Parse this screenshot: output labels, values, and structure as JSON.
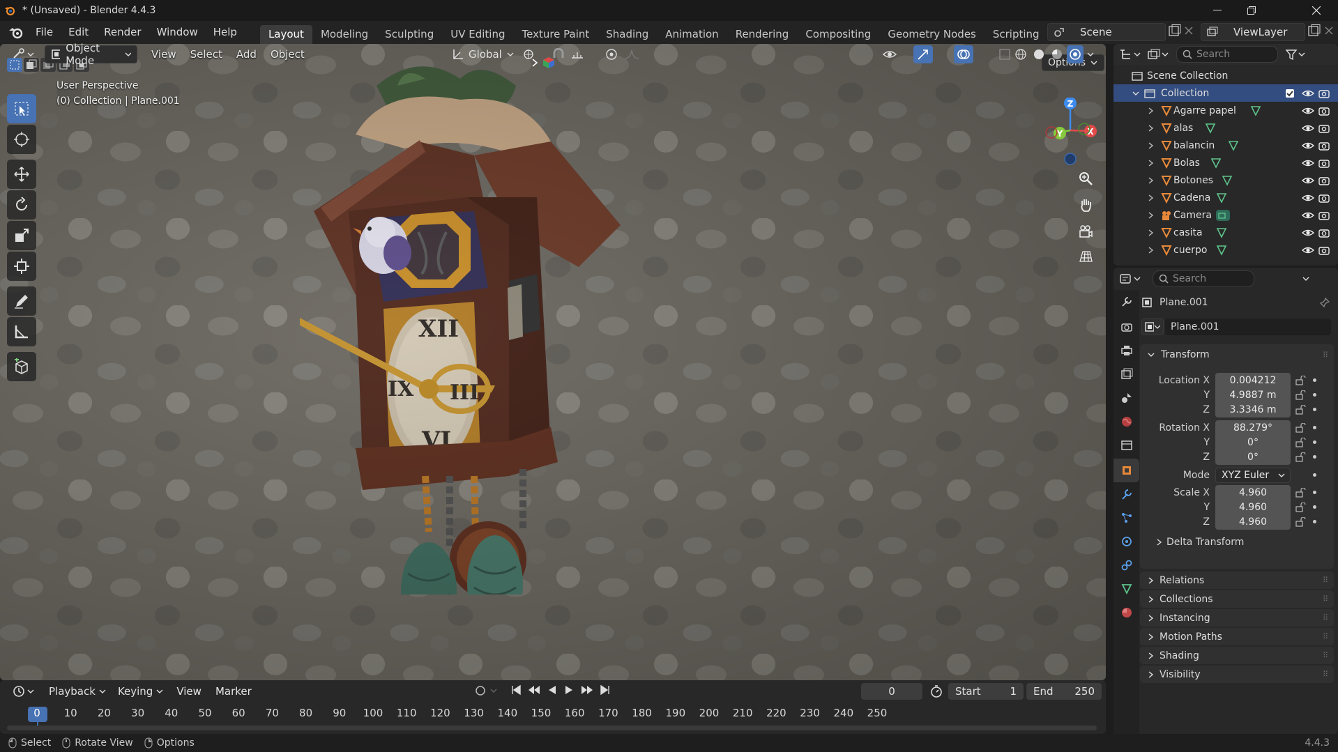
{
  "window": {
    "title": "* (Unsaved) - Blender 4.4.3"
  },
  "menu": [
    "File",
    "Edit",
    "Render",
    "Window",
    "Help"
  ],
  "workspaces": [
    {
      "label": "Layout",
      "active": true
    },
    {
      "label": "Modeling"
    },
    {
      "label": "Sculpting"
    },
    {
      "label": "UV Editing"
    },
    {
      "label": "Texture Paint"
    },
    {
      "label": "Shading"
    },
    {
      "label": "Animation"
    },
    {
      "label": "Rendering"
    },
    {
      "label": "Compositing"
    },
    {
      "label": "Geometry Nodes"
    },
    {
      "label": "Scripting"
    }
  ],
  "scene": {
    "name": "Scene",
    "view_layer": "ViewLayer"
  },
  "viewport": {
    "mode": "Object Mode",
    "menus": [
      "View",
      "Select",
      "Add",
      "Object"
    ],
    "transform_orientation": "Global",
    "options_label": "Options",
    "overlay_text": {
      "line1": "User Perspective",
      "line2": "(0) Collection | Plane.001"
    },
    "gizmo_axes": {
      "x": "X",
      "y": "Y",
      "z": "Z"
    }
  },
  "outliner": {
    "search_placeholder": "Search",
    "root": "Scene Collection",
    "collection": "Collection",
    "items": [
      {
        "name": "Agarre papel",
        "kind": "mesh"
      },
      {
        "name": "alas",
        "kind": "mesh"
      },
      {
        "name": "balancin",
        "kind": "mesh"
      },
      {
        "name": "Bolas",
        "kind": "mesh"
      },
      {
        "name": "Botones",
        "kind": "mesh"
      },
      {
        "name": "Cadena",
        "kind": "mesh"
      },
      {
        "name": "Camera",
        "kind": "camera"
      },
      {
        "name": "casita",
        "kind": "mesh"
      },
      {
        "name": "cuerpo",
        "kind": "mesh"
      }
    ]
  },
  "properties": {
    "search_placeholder": "Search",
    "object_name": "Plane.001",
    "datablock_name": "Plane.001",
    "transform": {
      "title": "Transform",
      "location_label": "Location X",
      "location": {
        "x": "0.004212",
        "y": "4.9887 m",
        "z": "3.3346 m"
      },
      "rotation_label": "Rotation X",
      "rotation": {
        "x": "88.279°",
        "y": "0°",
        "z": "0°"
      },
      "mode_label": "Mode",
      "mode": "XYZ Euler",
      "scale_label": "Scale X",
      "scale": {
        "x": "4.960",
        "y": "4.960",
        "z": "4.960"
      },
      "y_label": "Y",
      "z_label": "Z",
      "delta": "Delta Transform"
    },
    "panels": [
      "Relations",
      "Collections",
      "Instancing",
      "Motion Paths",
      "Shading",
      "Visibility"
    ]
  },
  "timeline": {
    "menus": [
      "Playback",
      "Keying",
      "View",
      "Marker"
    ],
    "current_frame": "0",
    "start_label": "Start",
    "start": "1",
    "end_label": "End",
    "end": "250",
    "ticks": [
      "0",
      "10",
      "20",
      "30",
      "40",
      "50",
      "60",
      "70",
      "80",
      "90",
      "100",
      "110",
      "120",
      "130",
      "140",
      "150",
      "160",
      "170",
      "180",
      "190",
      "200",
      "210",
      "220",
      "230",
      "240",
      "250"
    ]
  },
  "statusbar": {
    "items": [
      "Select",
      "Rotate View",
      "Options"
    ],
    "version": "4.4.3"
  },
  "colors": {
    "accent": "#4772b3",
    "mesh_icon": "#e8893a",
    "data_icon": "#5fc58c"
  }
}
